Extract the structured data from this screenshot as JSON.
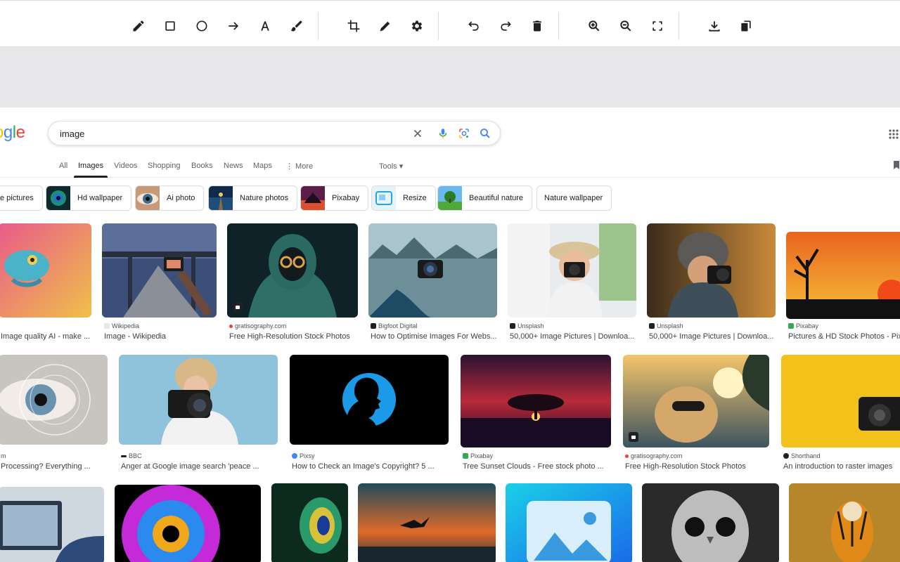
{
  "toolbar": {
    "tools": [
      "pencil-icon",
      "rectangle-icon",
      "circle-icon",
      "arrow-icon",
      "text-icon",
      "brush-icon",
      "crop-icon",
      "pen-icon",
      "settings-icon",
      "undo-icon",
      "redo-icon",
      "delete-icon",
      "zoom-in-icon",
      "zoom-out-icon",
      "fullscreen-icon",
      "download-icon",
      "copy-icon"
    ]
  },
  "search": {
    "query": "image",
    "logo_visible": "ogle"
  },
  "tabs": {
    "all": "All",
    "images": "Images",
    "videos": "Videos",
    "shopping": "Shopping",
    "books": "Books",
    "news": "News",
    "maps": "Maps",
    "more": "⋮ More",
    "tools": "Tools ▾"
  },
  "chips": [
    {
      "label": "e pictures"
    },
    {
      "label": "Hd wallpaper"
    },
    {
      "label": "Ai photo"
    },
    {
      "label": "Nature photos"
    },
    {
      "label": "Pixabay"
    },
    {
      "label": "Resize"
    },
    {
      "label": "Beautiful nature"
    },
    {
      "label": "Nature wallpaper"
    }
  ],
  "results": {
    "row1": [
      {
        "source": "",
        "title": "Image quality AI - make ..."
      },
      {
        "source": "Wikipedia",
        "title": "Image - Wikipedia"
      },
      {
        "source": "gratisography.com",
        "title": "Free High-Resolution Stock Photos"
      },
      {
        "source": "Bigfoot Digital",
        "title": "How to Optimise Images For Webs..."
      },
      {
        "source": "Unsplash",
        "title": "50,000+ Image Pictures | Downloa..."
      },
      {
        "source": "Unsplash",
        "title": "50,000+ Image Pictures | Downloa..."
      },
      {
        "source": "Pixabay",
        "title": "Pictures & HD Stock Photos - Pix"
      }
    ],
    "row2": [
      {
        "source": "m",
        "title": "Processing? Everything ..."
      },
      {
        "source": "BBC",
        "title": "Anger at Google image search 'peace ..."
      },
      {
        "source": "Pixsy",
        "title": "How to Check an Image's Copyright? 5 ..."
      },
      {
        "source": "Pixabay",
        "title": "Tree Sunset Clouds - Free stock photo ..."
      },
      {
        "source": "gratisography.com",
        "title": "Free High-Resolution Stock Photos"
      },
      {
        "source": "Shorthand",
        "title": "An introduction to raster images"
      }
    ]
  },
  "colors": {
    "accent_blue": "#1a73e8",
    "google_blue": "#4285f4",
    "google_red": "#ea4335",
    "google_yellow": "#fbbc05",
    "google_green": "#34a853"
  }
}
